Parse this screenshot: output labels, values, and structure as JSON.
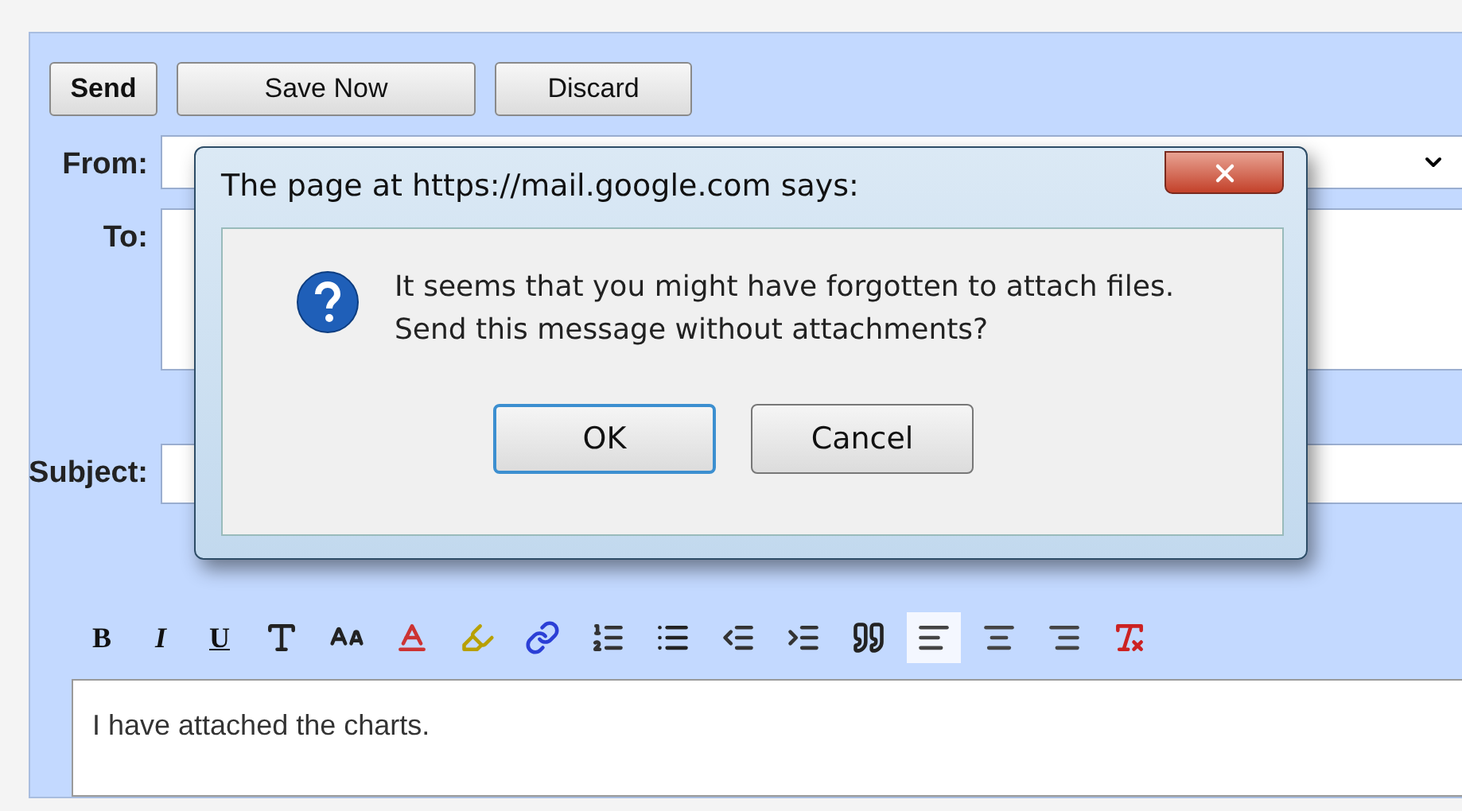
{
  "compose": {
    "buttons": [
      "Send",
      "Save Now",
      "Discard"
    ],
    "fields": [
      {
        "label": "From:"
      },
      {
        "label": "To:"
      },
      {
        "label": "Subject:"
      }
    ],
    "toolbar": {
      "text_buttons": [
        "B",
        "I",
        "U"
      ],
      "tools": [
        {
          "selected": false
        },
        {
          "selected": false
        },
        {
          "selected": false
        },
        {
          "selected": false
        },
        {
          "selected": false
        },
        {
          "selected": false
        },
        {
          "selected": false
        },
        {
          "selected": false
        },
        {
          "selected": false
        },
        {
          "selected": false
        },
        {
          "selected": true
        },
        {
          "selected": false
        },
        {
          "selected": false
        },
        {
          "selected": false
        }
      ]
    },
    "body": "I have attached the charts."
  },
  "dialog": {
    "title": "The page at https://mail.google.com says:",
    "message": [
      "It seems that you might have forgotten to attach files.",
      "Send this message without attachments?"
    ],
    "buttons": [
      {
        "label": "OK",
        "selected": true
      },
      {
        "label": "Cancel",
        "selected": false
      }
    ]
  }
}
